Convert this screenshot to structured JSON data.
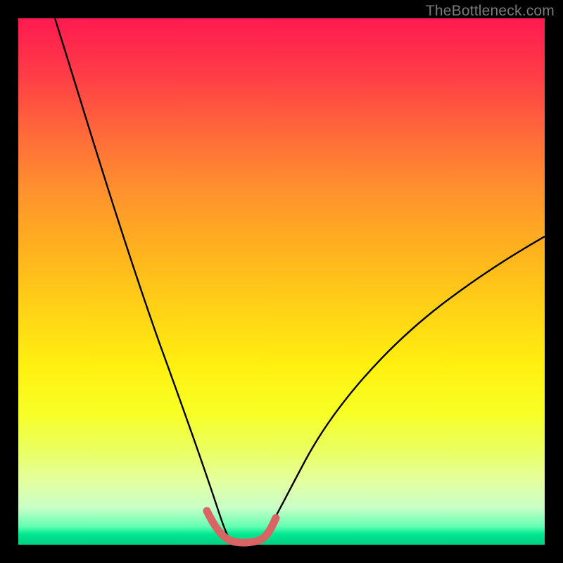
{
  "watermark": "TheBottleneck.com",
  "colors": {
    "curve": "#000000",
    "highlight": "#d96464",
    "frame": "#000000"
  },
  "chart_data": {
    "type": "line",
    "title": "",
    "xlabel": "",
    "ylabel": "",
    "xlim": [
      0,
      100
    ],
    "ylim": [
      0,
      100
    ],
    "grid": false,
    "legend": false,
    "series": [
      {
        "name": "left-curve",
        "x": [
          7,
          10,
          14,
          18,
          22,
          25,
          28,
          30,
          32,
          34,
          35.5,
          37,
          38,
          39,
          39.8
        ],
        "y": [
          100,
          88,
          73,
          59,
          46,
          36,
          27,
          20.5,
          14.5,
          9.5,
          6,
          3.4,
          2,
          1.2,
          1
        ]
      },
      {
        "name": "valley-floor",
        "x": [
          39.8,
          41,
          42.5,
          44,
          45.5,
          47
        ],
        "y": [
          1,
          0.8,
          0.8,
          0.9,
          1.2,
          1.8
        ]
      },
      {
        "name": "right-curve",
        "x": [
          47,
          49,
          51,
          54,
          58,
          63,
          69,
          76,
          84,
          92,
          100
        ],
        "y": [
          1.8,
          4,
          7,
          12,
          18,
          25,
          32,
          39,
          46,
          53,
          59
        ]
      },
      {
        "name": "highlight-segment",
        "x": [
          35.5,
          37,
          38,
          39,
          39.8,
          41,
          42.5,
          44,
          45.5,
          47,
          48.2
        ],
        "y": [
          6,
          3.4,
          2,
          1.2,
          1,
          0.8,
          0.8,
          0.9,
          1.2,
          1.8,
          3
        ]
      }
    ],
    "note": "y is bottleneck percentage (0 = ideal, 100 = severe). Background gradient maps y to color: green near 0, red near 100. Values are read off an unlabeled plot and are approximate."
  }
}
